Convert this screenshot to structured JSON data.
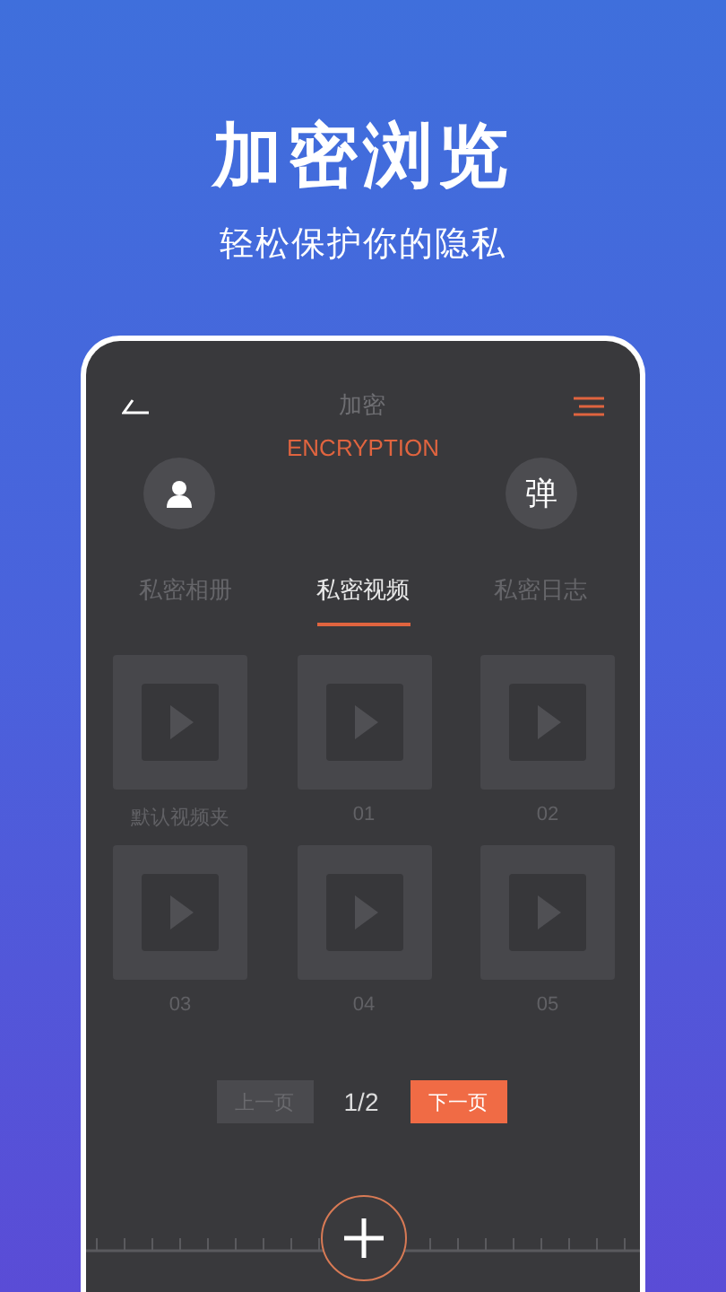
{
  "headline": "加密浏览",
  "subheadline": "轻松保护你的隐私",
  "screen": {
    "title": "加密",
    "subtitle": "ENCRYPTION",
    "badge": "弹",
    "tabs": [
      {
        "label": "私密相册",
        "selected": false
      },
      {
        "label": "私密视频",
        "selected": true
      },
      {
        "label": "私密日志",
        "selected": false
      }
    ],
    "videos": [
      {
        "label": "默认视频夹"
      },
      {
        "label": "01"
      },
      {
        "label": "02"
      },
      {
        "label": "03"
      },
      {
        "label": "04"
      },
      {
        "label": "05"
      }
    ],
    "pagination": {
      "prev": "上一页",
      "prev_disabled": true,
      "page": "1/2",
      "next": "下一页"
    }
  }
}
